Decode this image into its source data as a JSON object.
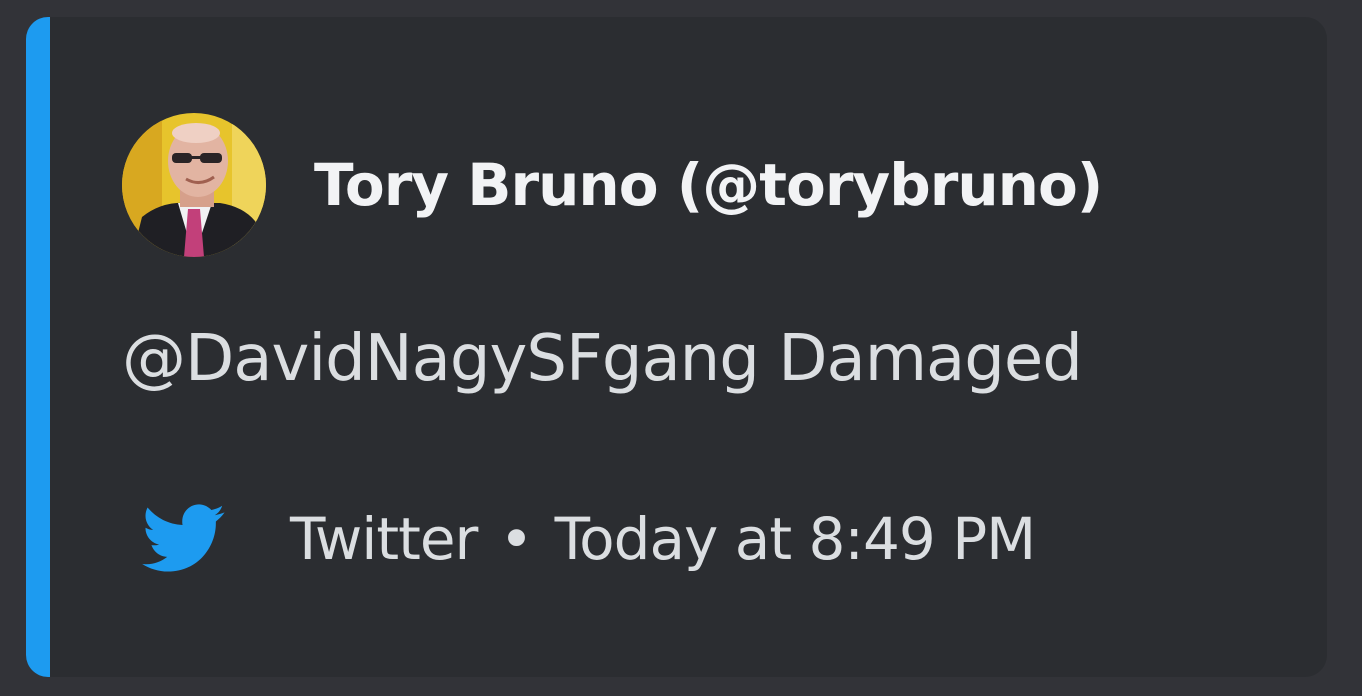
{
  "embed": {
    "accent_color": "#1d9bf0",
    "author": {
      "name": "Tory Bruno (@torybruno)",
      "avatar_icon": "profile-photo-avatar"
    },
    "description": "@DavidNagySFgang Damaged",
    "footer": {
      "icon": "twitter-bird-icon",
      "source": "Twitter",
      "separator": "•",
      "timestamp": "Today at 8:49 PM"
    }
  }
}
